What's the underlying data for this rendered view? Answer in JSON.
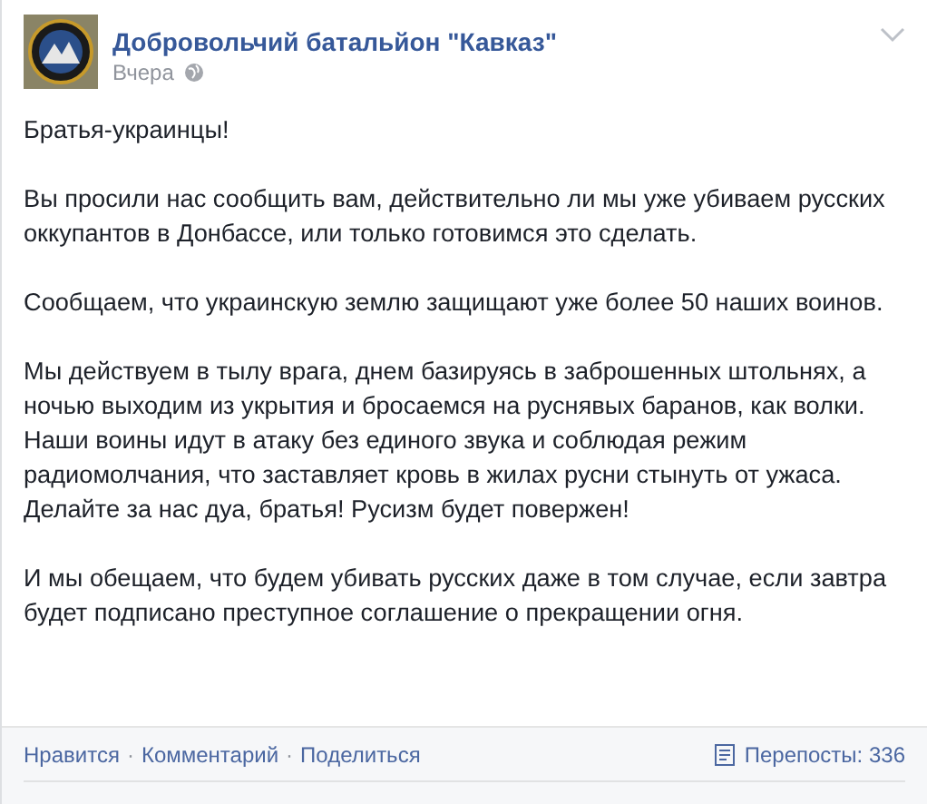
{
  "post": {
    "author": "Добровольчий батальйон \"Кавказ\"",
    "time": "Вчера",
    "paragraphs": [
      "Братья-украинцы!",
      "Вы просили нас сообщить вам, действительно ли мы уже убиваем русских оккупантов в Донбассе, или только готовимся это сделать.",
      "Сообщаем, что украинскую землю защищают уже более 50 наших воинов.",
      "Мы действуем в тылу врага, днем базируясь в заброшенных штольнях, а ночью выходим из укрытия и бросаемся на руснявых баранов, как волки. Наши воины идут в атаку без единого звука и соблюдая режим радиомолчания, что заставляет кровь в жилах русни стынуть от ужаса. Делайте за нас дуа, братья! Русизм будет повержен!",
      "И мы обещаем, что будем убивать русских даже в том случае, если завтра будет подписано преступное соглашение о прекращении огня."
    ]
  },
  "actions": [
    "Нравится",
    "Комментарий",
    "Поделиться"
  ],
  "separator": "·",
  "reposts": "Перепосты: 336"
}
